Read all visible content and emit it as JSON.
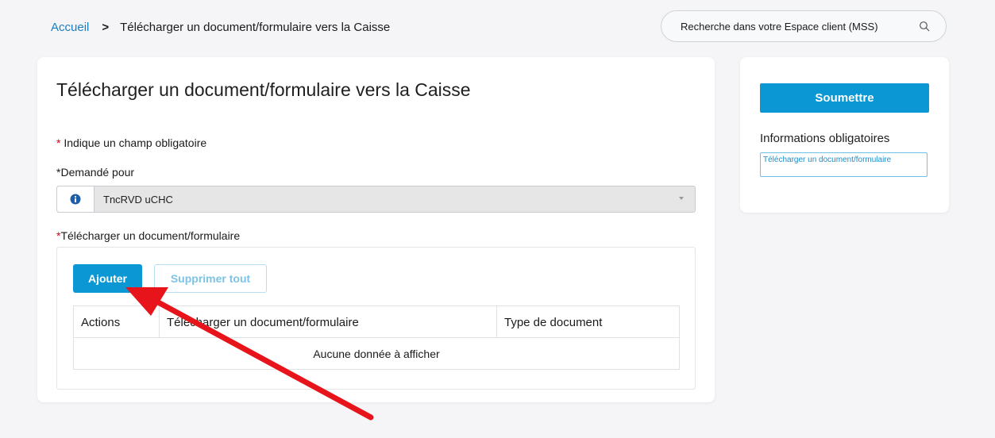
{
  "breadcrumb": {
    "home": "Accueil",
    "separator": ">",
    "current": "Télécharger un document/formulaire vers la Caisse"
  },
  "search": {
    "placeholder": "Recherche dans votre Espace client (MSS)",
    "icon": "search-icon"
  },
  "form": {
    "title": "Télécharger un document/formulaire vers la Caisse",
    "required_marker": "*",
    "required_note": "Indique un champ obligatoire",
    "requested_for_label": "Demandé pour",
    "requested_for_value": "TncRVD uCHC",
    "upload_label": "Télécharger un document/formulaire",
    "add_button": "Ajouter",
    "delete_all_button": "Supprimer tout",
    "table": {
      "columns": [
        "Actions",
        "Télécharger un document/formulaire",
        "Type de document"
      ],
      "empty_message": "Aucune donnée à afficher"
    }
  },
  "sidebar": {
    "submit_button": "Soumettre",
    "mandatory_title": "Informations obligatoires",
    "mandatory_items": [
      "Télécharger un document/formulaire"
    ]
  },
  "colors": {
    "accent": "#0b97d4",
    "link": "#1a7ec4",
    "required": "#d0021b",
    "annotation_arrow": "#e8141b"
  }
}
